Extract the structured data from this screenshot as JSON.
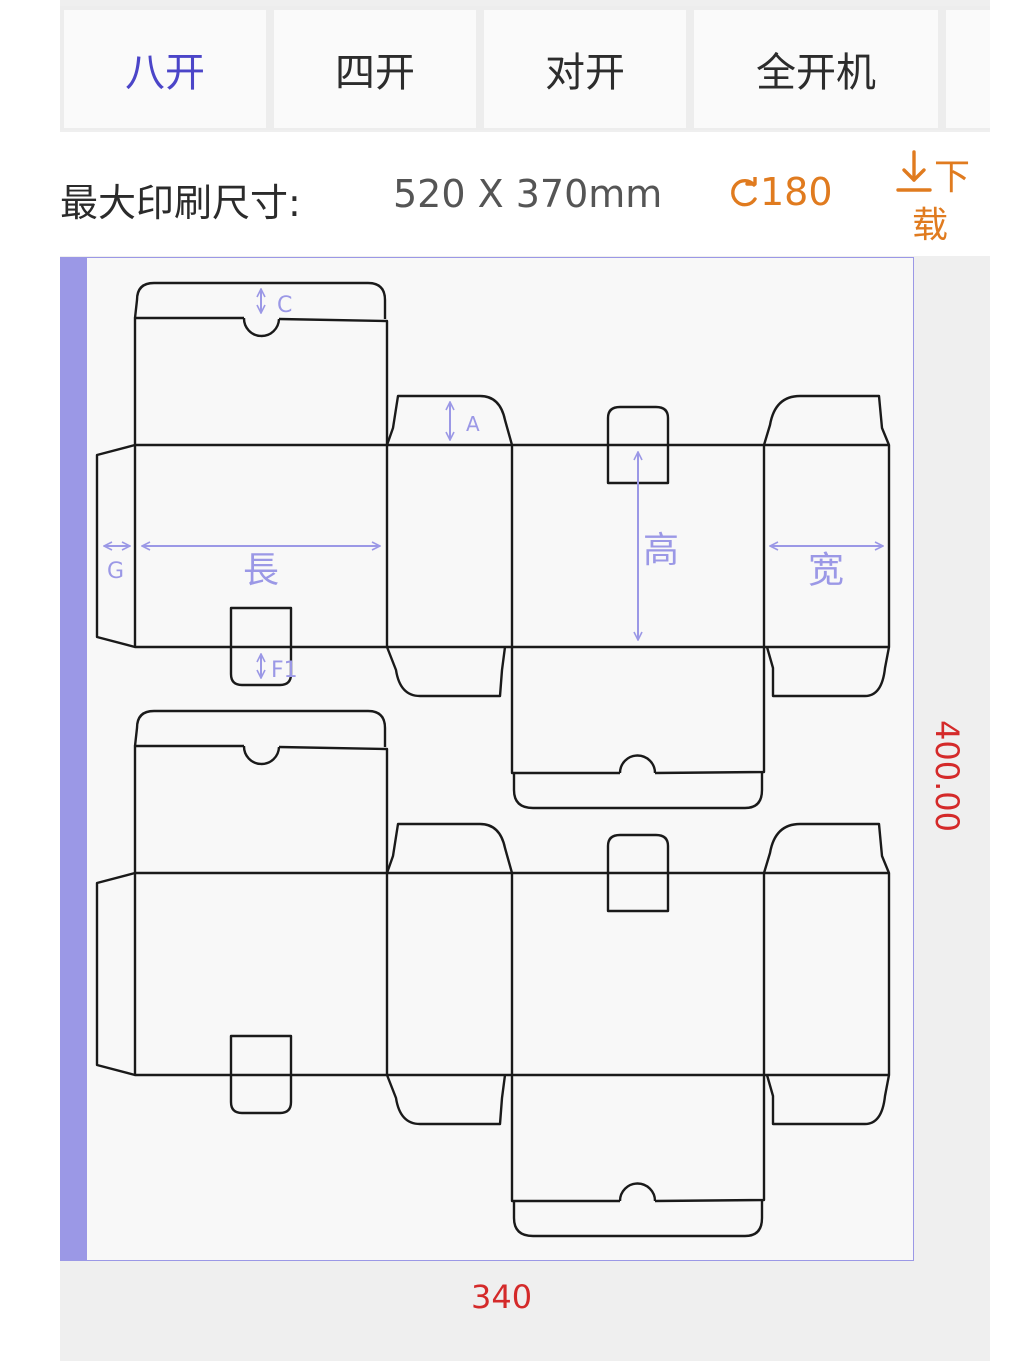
{
  "tabs": [
    {
      "label": "八开",
      "active": true
    },
    {
      "label": "四开",
      "active": false
    },
    {
      "label": "对开",
      "active": false
    },
    {
      "label": "全开机",
      "active": false
    }
  ],
  "info": {
    "label": "最大印刷尺寸:",
    "size": "520 X 370mm",
    "rotate_icon": "rotate-icon",
    "rotate_value": "180",
    "download_char1": "下",
    "download_char2": "载"
  },
  "dieline": {
    "labels": {
      "c": "C",
      "a": "A",
      "g": "G",
      "f1": "F1",
      "length": "長",
      "height": "高",
      "width": "宽"
    },
    "width_dim": "340",
    "height_dim": "400.00"
  },
  "colors": {
    "active_tab": "#4b45c8",
    "accent": "#e07b1f",
    "dimension": "#d42a2a",
    "guide": "#9b98e6"
  }
}
